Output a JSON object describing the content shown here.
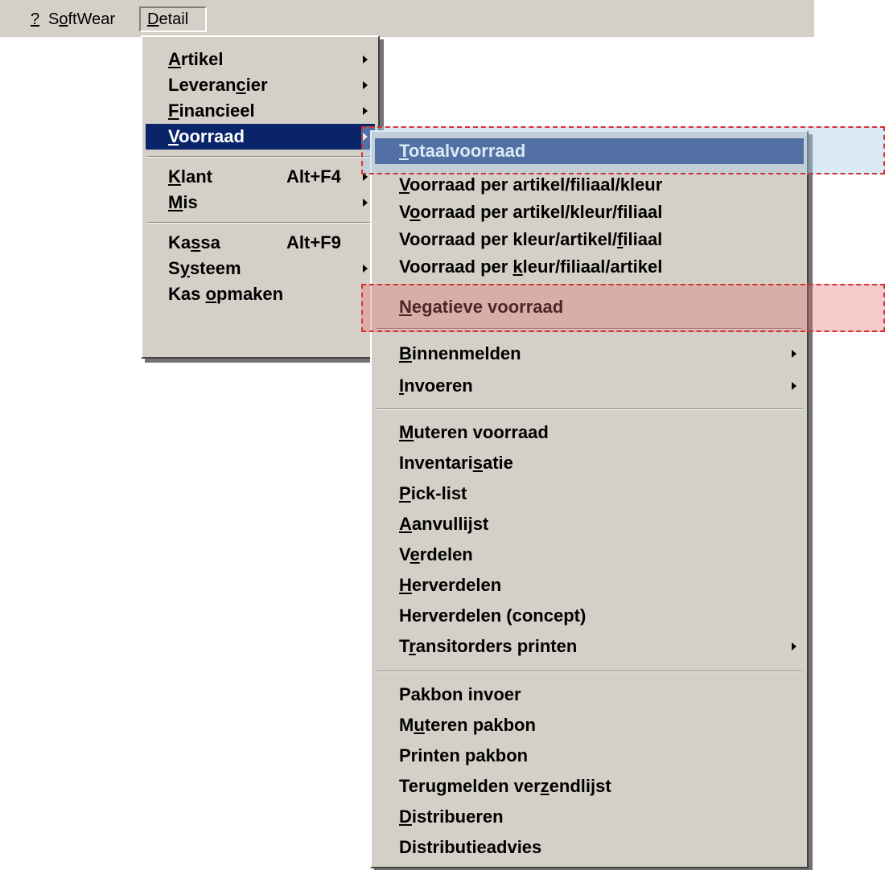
{
  "menubar": {
    "help": {
      "mnemonic": "?",
      "rest": ""
    },
    "softwear": {
      "pre": "S",
      "mnemonic": "o",
      "rest": "ftWear"
    },
    "detail": {
      "mnemonic": "D",
      "rest": "etail"
    }
  },
  "detail_menu": {
    "artikel": {
      "pre": "",
      "mnemonic": "A",
      "rest": "rtikel"
    },
    "leverancier": {
      "pre": "Leveran",
      "mnemonic": "c",
      "rest": "ier"
    },
    "financieel": {
      "pre": "",
      "mnemonic": "F",
      "rest": "inancieel"
    },
    "voorraad": {
      "pre": "",
      "mnemonic": "V",
      "rest": "oorraad"
    },
    "klant": {
      "pre": "",
      "mnemonic": "K",
      "rest": "lant",
      "shortcut": "Alt+F4"
    },
    "mis": {
      "pre": "",
      "mnemonic": "M",
      "rest": "is"
    },
    "kassa": {
      "pre": "Ka",
      "mnemonic": "s",
      "rest": "sa",
      "shortcut": "Alt+F9"
    },
    "systeem": {
      "pre": "S",
      "mnemonic": "y",
      "rest": "steem"
    },
    "kas_opmaken": {
      "pre": "Kas ",
      "mnemonic": "o",
      "rest": "pmaken"
    }
  },
  "voorraad_menu": {
    "totaalvoorraad": {
      "pre": "",
      "mnemonic": "T",
      "rest": "otaalvoorraad"
    },
    "per_art_fil_kleur": {
      "pre": "",
      "mnemonic": "V",
      "rest": "oorraad per artikel/filiaal/kleur"
    },
    "per_art_kleur_fil": {
      "pre": "V",
      "mnemonic": "o",
      "rest": "orraad per artikel/kleur/filiaal"
    },
    "per_kleur_art_fil": {
      "pre": "Voorraad per kleur/artikel/",
      "mnemonic": "f",
      "rest": "iliaal"
    },
    "per_kleur_fil_art": {
      "pre": "Voorraad per ",
      "mnemonic": "k",
      "rest": "leur/filiaal/artikel"
    },
    "negatieve": {
      "pre": "",
      "mnemonic": "N",
      "rest": "egatieve voorraad"
    },
    "binnenmelden": {
      "pre": "",
      "mnemonic": "B",
      "rest": "innenmelden"
    },
    "invoeren": {
      "pre": "",
      "mnemonic": "I",
      "rest": "nvoeren"
    },
    "muteren_voorraad": {
      "pre": "",
      "mnemonic": "M",
      "rest": "uteren voorraad"
    },
    "inventarisatie": {
      "pre": "Inventari",
      "mnemonic": "s",
      "rest": "atie"
    },
    "pick_list": {
      "pre": "",
      "mnemonic": "P",
      "rest": "ick-list"
    },
    "aanvullijst": {
      "pre": "",
      "mnemonic": "A",
      "rest": "anvullijst"
    },
    "verdelen": {
      "pre": "V",
      "mnemonic": "e",
      "rest": "rdelen"
    },
    "herverdelen": {
      "pre": "",
      "mnemonic": "H",
      "rest": "erverdelen"
    },
    "herverdelen_concept": {
      "pre": "Herverdelen (concept)",
      "mnemonic": "",
      "rest": ""
    },
    "transitorders": {
      "pre": "T",
      "mnemonic": "r",
      "rest": "ansitorders printen"
    },
    "pakbon_invoer": {
      "pre": "Pakbon invoer",
      "mnemonic": "",
      "rest": ""
    },
    "muteren_pakbon": {
      "pre": "M",
      "mnemonic": "u",
      "rest": "teren pakbon"
    },
    "printen_pakbon": {
      "pre": "Printen pakbon",
      "mnemonic": "",
      "rest": ""
    },
    "terugmelden": {
      "pre": "Terugmelden ver",
      "mnemonic": "z",
      "rest": "endlijst"
    },
    "distribueren": {
      "pre": "",
      "mnemonic": "D",
      "rest": "istribueren"
    },
    "distributieadvies": {
      "pre": "Distributieadvies",
      "mnemonic": "",
      "rest": ""
    }
  }
}
